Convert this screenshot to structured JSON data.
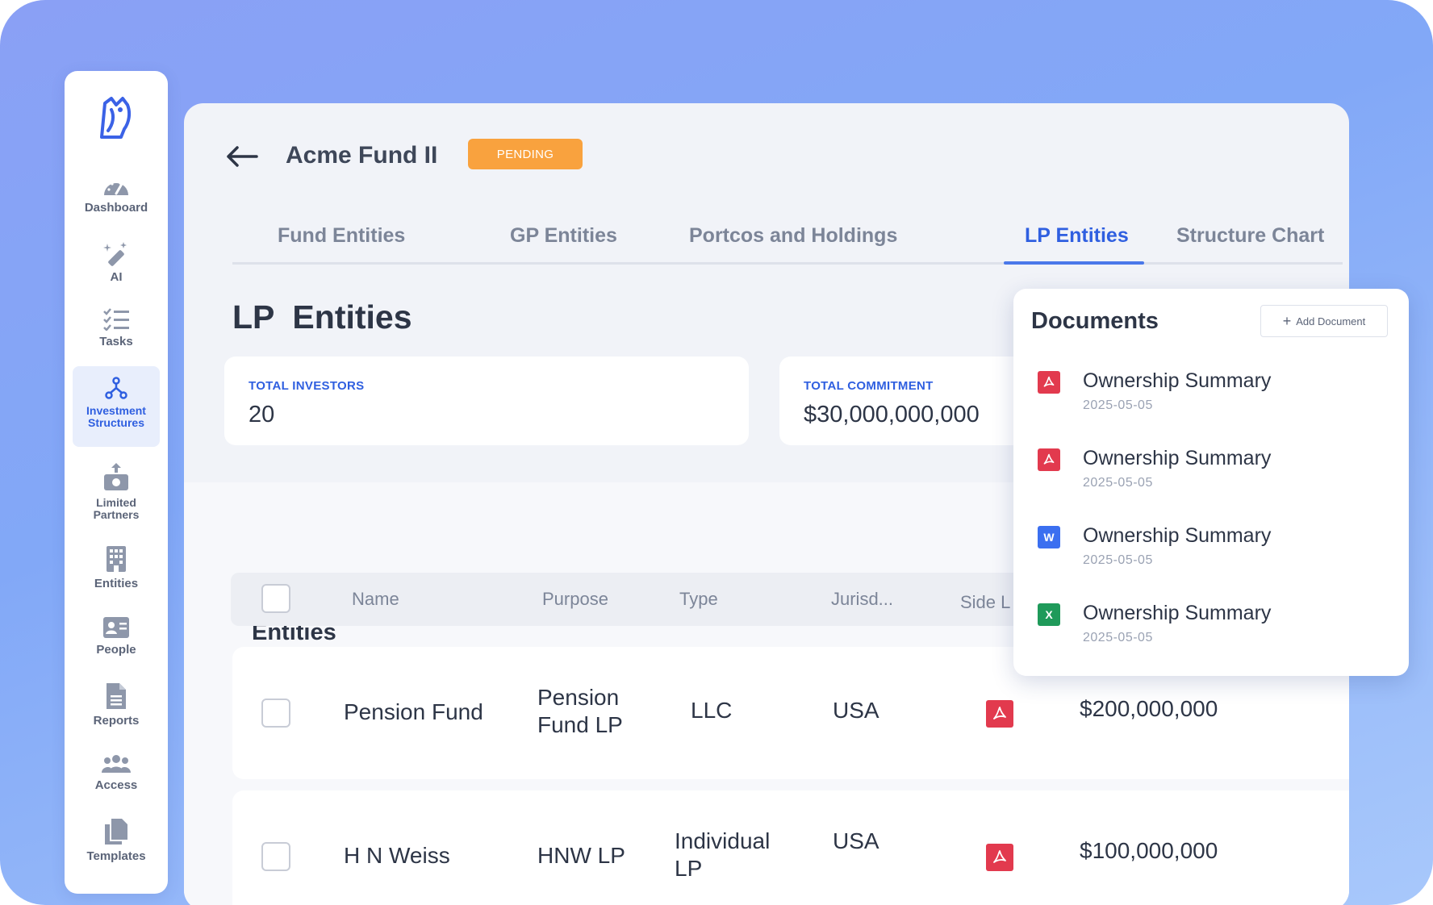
{
  "sidebar": {
    "items": [
      {
        "label": "Dashboard",
        "icon": "gauge-icon"
      },
      {
        "label": "AI",
        "icon": "magic-wand-icon"
      },
      {
        "label": "Tasks",
        "icon": "checklist-icon"
      },
      {
        "label": "Investment Structures",
        "icon": "structure-icon"
      },
      {
        "label": "Limited Partners",
        "icon": "money-icon"
      },
      {
        "label": "Entities",
        "icon": "building-icon"
      },
      {
        "label": "People",
        "icon": "id-card-icon"
      },
      {
        "label": "Reports",
        "icon": "document-icon"
      },
      {
        "label": "Access",
        "icon": "users-icon"
      },
      {
        "label": "Templates",
        "icon": "copy-icon"
      }
    ],
    "active": "Investment Structures"
  },
  "header": {
    "title": "Acme Fund II",
    "status": "PENDING"
  },
  "tabs": [
    {
      "label": "Fund Entities"
    },
    {
      "label": "GP Entities"
    },
    {
      "label": "Portcos and Holdings"
    },
    {
      "label": "LP Entities"
    },
    {
      "label": "Structure Chart"
    }
  ],
  "active_tab": "LP Entities",
  "page_title": "LP  Entities",
  "stats": {
    "investors_label": "TOTAL INVESTORS",
    "investors_value": "20",
    "commitment_label": "TOTAL COMMITMENT",
    "commitment_value": "$30,000,000,000"
  },
  "table": {
    "title": "Entities",
    "columns": [
      "Name",
      "Purpose",
      "Type",
      "Jurisd...",
      "Side L"
    ],
    "rows": [
      {
        "name": "Pension Fund",
        "purpose": "Pension Fund LP",
        "type": "LLC",
        "jurisdiction": "USA",
        "amount": "$200,000,000"
      },
      {
        "name": "H N Weiss",
        "purpose": "HNW LP",
        "type": "Individual LP",
        "jurisdiction": "USA",
        "amount": "$100,000,000"
      }
    ]
  },
  "documents": {
    "title": "Documents",
    "add_label": "Add Document",
    "items": [
      {
        "name": "Ownership Summary",
        "date": "2025-05-05",
        "type": "pdf",
        "color": "#e23a4e"
      },
      {
        "name": "Ownership Summary",
        "date": "2025-05-05",
        "type": "pdf",
        "color": "#e23a4e"
      },
      {
        "name": "Ownership Summary",
        "date": "2025-05-05",
        "type": "word",
        "letter": "W",
        "color": "#3b6ff0"
      },
      {
        "name": "Ownership Summary",
        "date": "2025-05-05",
        "type": "excel",
        "letter": "X",
        "color": "#1f9a5a"
      }
    ]
  },
  "colors": {
    "accent": "#2f5fe0",
    "pending": "#f9a23e",
    "pdf": "#e23a4e"
  }
}
